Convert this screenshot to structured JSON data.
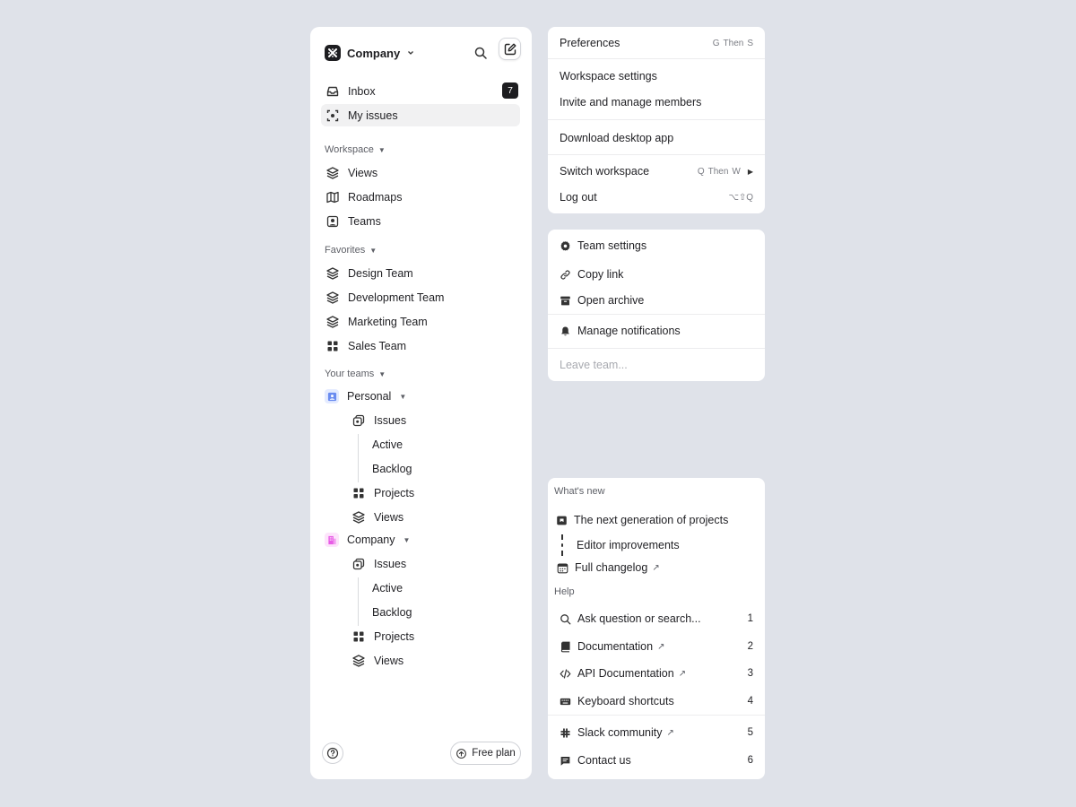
{
  "sidebar": {
    "workspace_name": "Company",
    "nav": [
      {
        "label": "Inbox",
        "badge": "7"
      },
      {
        "label": "My issues"
      }
    ],
    "workspace_section": {
      "title": "Workspace",
      "items": [
        {
          "label": "Views",
          "icon": "layers-icon"
        },
        {
          "label": "Roadmaps",
          "icon": "map-icon"
        },
        {
          "label": "Teams",
          "icon": "user-square-icon"
        }
      ]
    },
    "favorites_section": {
      "title": "Favorites",
      "items": [
        {
          "label": "Design Team",
          "icon": "layers-icon"
        },
        {
          "label": "Development Team",
          "icon": "layers-icon"
        },
        {
          "label": "Marketing Team",
          "icon": "layers-icon"
        },
        {
          "label": "Sales Team",
          "icon": "grid-icon"
        }
      ]
    },
    "teams_section": {
      "title": "Your teams",
      "teams": [
        {
          "name": "Personal",
          "chip_color": "#6a8cf0",
          "issues": "Issues",
          "active": "Active",
          "backlog": "Backlog",
          "projects": "Projects",
          "views": "Views"
        },
        {
          "name": "Company",
          "chip_color": "#e85ce6",
          "issues": "Issues",
          "active": "Active",
          "backlog": "Backlog",
          "projects": "Projects",
          "views": "Views"
        }
      ]
    },
    "footer": {
      "plan_label": "Free plan"
    }
  },
  "account_menu": {
    "preferences": {
      "label": "Preferences",
      "shortcut_key1": "G",
      "shortcut_then": "Then",
      "shortcut_key2": "S"
    },
    "workspace_settings": "Workspace settings",
    "invite_members": "Invite and manage members",
    "download_app": "Download desktop app",
    "switch_workspace": {
      "label": "Switch workspace",
      "shortcut_key1": "Q",
      "shortcut_then": "Then",
      "shortcut_key2": "W"
    },
    "log_out": {
      "label": "Log out",
      "shortcut": "⌥⇧Q"
    }
  },
  "team_menu": {
    "team_settings": "Team settings",
    "copy_link": "Copy link",
    "open_archive": "Open archive",
    "manage_notifications": "Manage notifications",
    "leave_team": "Leave team..."
  },
  "help_menu": {
    "whats_new_title": "What's new",
    "whats_new": [
      {
        "label": "The next generation of projects"
      },
      {
        "label": "Editor improvements"
      },
      {
        "label": "Full changelog",
        "external": "↗"
      }
    ],
    "help_title": "Help",
    "help_items": [
      {
        "label": "Ask question or search...",
        "num": "1"
      },
      {
        "label": "Documentation",
        "external": "↗",
        "num": "2"
      },
      {
        "label": "API Documentation",
        "external": "↗",
        "num": "3"
      },
      {
        "label": "Keyboard shortcuts",
        "num": "4"
      },
      {
        "label": "Slack community",
        "external": "↗",
        "num": "5"
      },
      {
        "label": "Contact us",
        "num": "6"
      }
    ]
  },
  "colors": {
    "background": "#dfe2e9",
    "panel": "#ffffff",
    "badge": "#1d1d20"
  }
}
